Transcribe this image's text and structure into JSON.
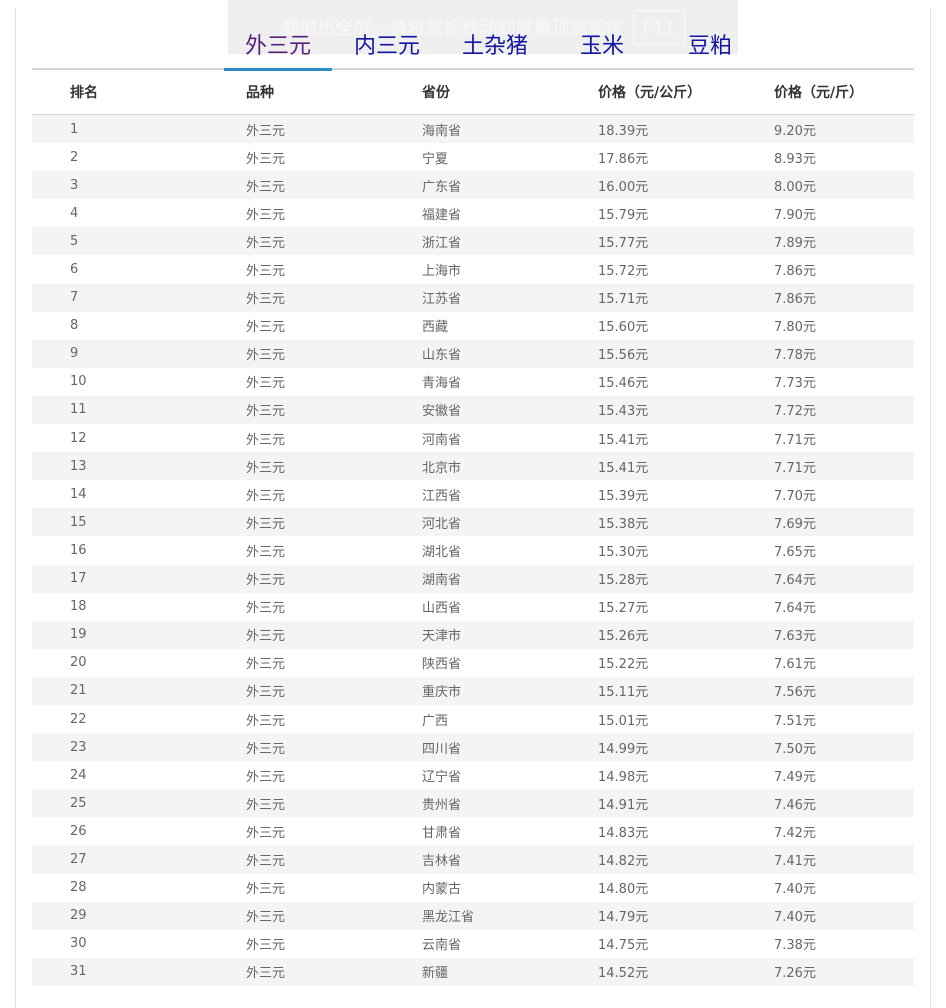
{
  "overlay": {
    "message": "要退出全屏，请将鼠标移动到屏幕顶端或按",
    "key": "F11"
  },
  "tabs": [
    "外三元",
    "内三元",
    "土杂猪",
    "玉米",
    "豆粕"
  ],
  "active_tab": "外三元",
  "columns": [
    "排名",
    "品种",
    "省份",
    "价格（元/公斤）",
    "价格（元/斤）"
  ],
  "rows": [
    [
      "1",
      "外三元",
      "海南省",
      "18.39元",
      "9.20元"
    ],
    [
      "2",
      "外三元",
      "宁夏",
      "17.86元",
      "8.93元"
    ],
    [
      "3",
      "外三元",
      "广东省",
      "16.00元",
      "8.00元"
    ],
    [
      "4",
      "外三元",
      "福建省",
      "15.79元",
      "7.90元"
    ],
    [
      "5",
      "外三元",
      "浙江省",
      "15.77元",
      "7.89元"
    ],
    [
      "6",
      "外三元",
      "上海市",
      "15.72元",
      "7.86元"
    ],
    [
      "7",
      "外三元",
      "江苏省",
      "15.71元",
      "7.86元"
    ],
    [
      "8",
      "外三元",
      "西藏",
      "15.60元",
      "7.80元"
    ],
    [
      "9",
      "外三元",
      "山东省",
      "15.56元",
      "7.78元"
    ],
    [
      "10",
      "外三元",
      "青海省",
      "15.46元",
      "7.73元"
    ],
    [
      "11",
      "外三元",
      "安徽省",
      "15.43元",
      "7.72元"
    ],
    [
      "12",
      "外三元",
      "河南省",
      "15.41元",
      "7.71元"
    ],
    [
      "13",
      "外三元",
      "北京市",
      "15.41元",
      "7.71元"
    ],
    [
      "14",
      "外三元",
      "江西省",
      "15.39元",
      "7.70元"
    ],
    [
      "15",
      "外三元",
      "河北省",
      "15.38元",
      "7.69元"
    ],
    [
      "16",
      "外三元",
      "湖北省",
      "15.30元",
      "7.65元"
    ],
    [
      "17",
      "外三元",
      "湖南省",
      "15.28元",
      "7.64元"
    ],
    [
      "18",
      "外三元",
      "山西省",
      "15.27元",
      "7.64元"
    ],
    [
      "19",
      "外三元",
      "天津市",
      "15.26元",
      "7.63元"
    ],
    [
      "20",
      "外三元",
      "陕西省",
      "15.22元",
      "7.61元"
    ],
    [
      "21",
      "外三元",
      "重庆市",
      "15.11元",
      "7.56元"
    ],
    [
      "22",
      "外三元",
      "广西",
      "15.01元",
      "7.51元"
    ],
    [
      "23",
      "外三元",
      "四川省",
      "14.99元",
      "7.50元"
    ],
    [
      "24",
      "外三元",
      "辽宁省",
      "14.98元",
      "7.49元"
    ],
    [
      "25",
      "外三元",
      "贵州省",
      "14.91元",
      "7.46元"
    ],
    [
      "26",
      "外三元",
      "甘肃省",
      "14.83元",
      "7.42元"
    ],
    [
      "27",
      "外三元",
      "吉林省",
      "14.82元",
      "7.41元"
    ],
    [
      "28",
      "外三元",
      "内蒙古",
      "14.80元",
      "7.40元"
    ],
    [
      "29",
      "外三元",
      "黑龙江省",
      "14.79元",
      "7.40元"
    ],
    [
      "30",
      "外三元",
      "云南省",
      "14.75元",
      "7.38元"
    ],
    [
      "31",
      "外三元",
      "新疆",
      "14.52元",
      "7.26元"
    ]
  ]
}
